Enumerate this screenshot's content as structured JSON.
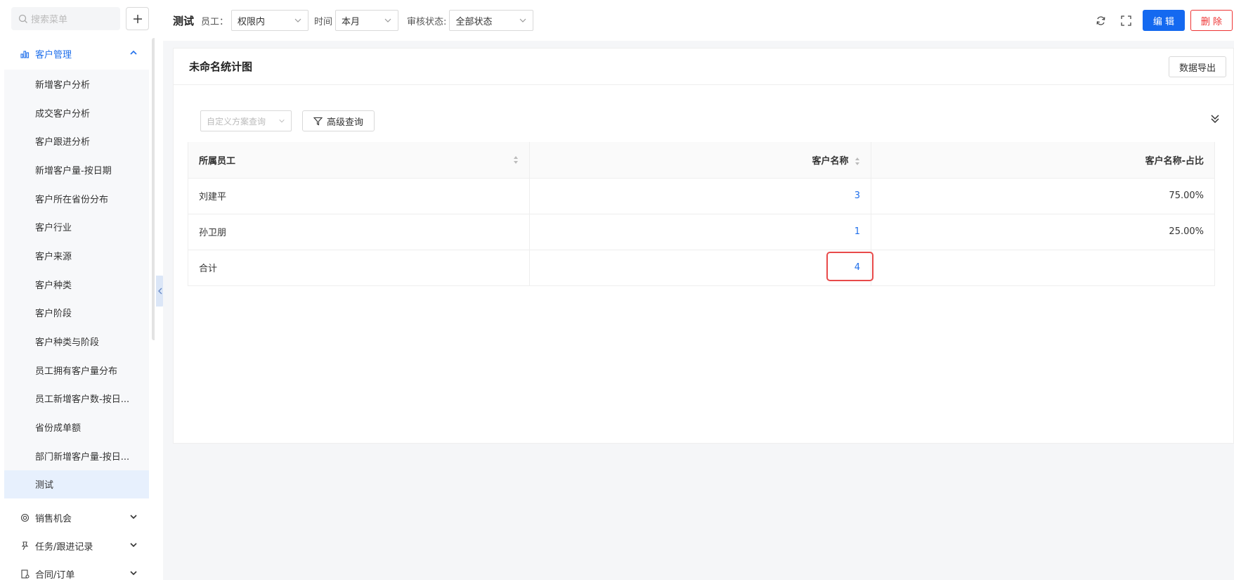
{
  "sidebar": {
    "search_placeholder": "搜索菜单",
    "group_active": {
      "label": "客户管理",
      "icon": "chart-icon"
    },
    "items": [
      "新增客户分析",
      "成交客户分析",
      "客户跟进分析",
      "新增客户量-按日期",
      "客户所在省份分布",
      "客户行业",
      "客户来源",
      "客户种类",
      "客户阶段",
      "客户种类与阶段",
      "员工拥有客户量分布",
      "员工新增客户数-按日...",
      "省份成单额",
      "部门新增客户量-按日...",
      "测试"
    ],
    "groups_collapsed": [
      {
        "label": "销售机会",
        "icon": "target-icon"
      },
      {
        "label": "任务/跟进记录",
        "icon": "pin-icon"
      },
      {
        "label": "合同/订单",
        "icon": "contract-icon"
      }
    ]
  },
  "topbar": {
    "title": "测试",
    "employee_label": "员工：",
    "employee_value": "权限内",
    "time_label": "时间",
    "time_value": "本月",
    "status_label": "审核状态:",
    "status_value": "全部状态",
    "edit_label": "编 辑",
    "delete_label": "删 除"
  },
  "card": {
    "title": "未命名统计图",
    "export_label": "数据导出",
    "scheme_placeholder": "自定义方案查询",
    "advanced_label": "高级查询"
  },
  "table": {
    "headers": [
      "所属员工",
      "客户名称",
      "客户名称-占比"
    ],
    "rows": [
      {
        "employee": "刘建平",
        "count": "3",
        "ratio": "75.00%"
      },
      {
        "employee": "孙卫朋",
        "count": "1",
        "ratio": "25.00%"
      }
    ],
    "total": {
      "label": "合计",
      "count": "4",
      "ratio": ""
    }
  },
  "colors": {
    "primary": "#1469f0",
    "danger": "#e33333",
    "highlight": "#e84a4a"
  }
}
